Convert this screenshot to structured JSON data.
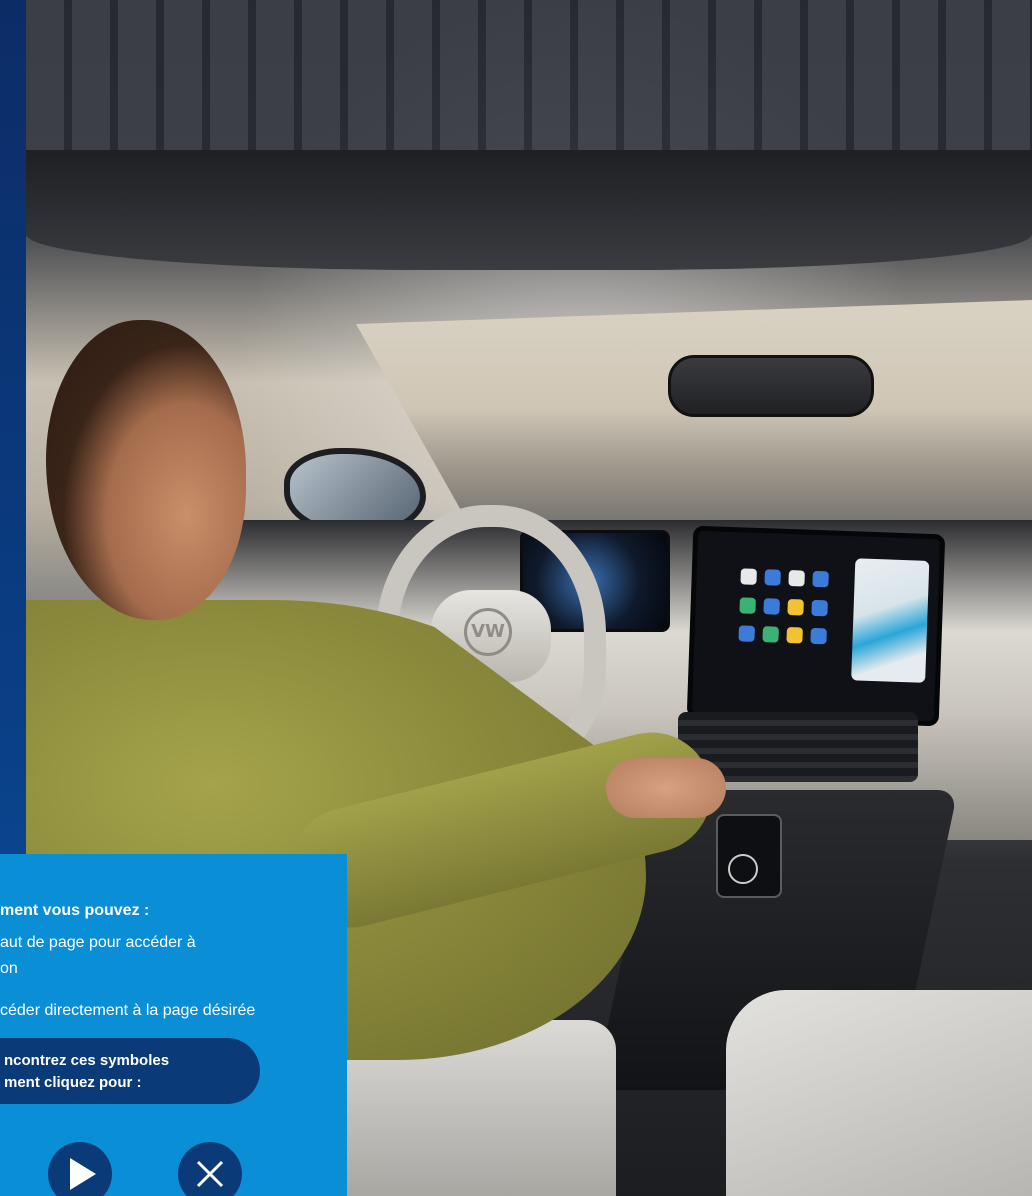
{
  "info_panel": {
    "heading": "ment vous pouvez :",
    "line1a": "aut de page pour accéder à",
    "line1b": "on",
    "line2": "céder directement à la page désirée",
    "symbols_line1": "ncontrez ces symboles",
    "symbols_line2": "ment cliquez pour :",
    "icons": [
      "play-icon",
      "close-icon"
    ]
  },
  "scene": {
    "brand_badge": "VW"
  },
  "colors": {
    "panel_blue": "#0a8fd6",
    "navy": "#0a3b78",
    "rail_blue": "#0a3f86"
  }
}
